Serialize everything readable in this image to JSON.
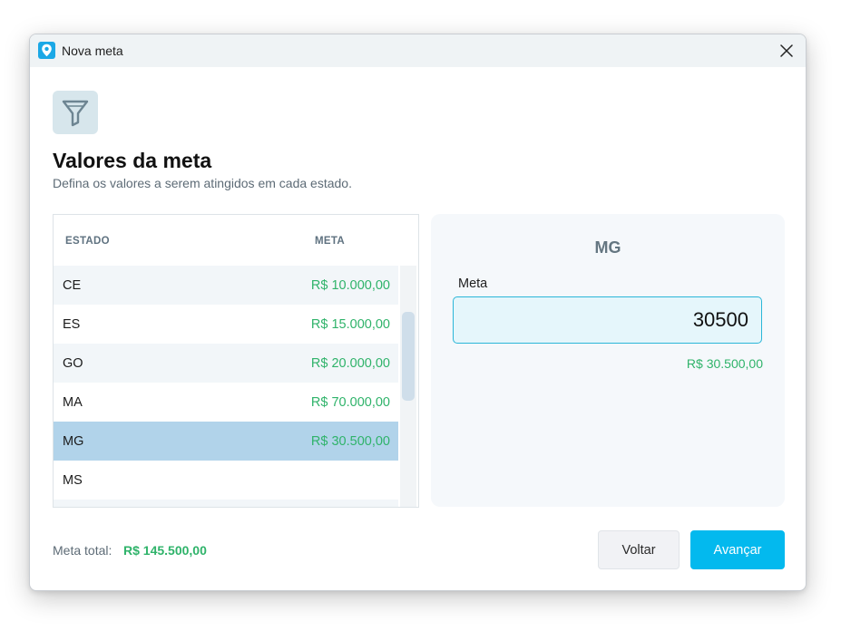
{
  "window": {
    "title": "Nova meta",
    "app_icon": "map-pin-icon",
    "close_icon": "close-icon"
  },
  "header": {
    "icon": "funnel-icon",
    "title": "Valores da meta",
    "subtitle": "Defina os valores a serem atingidos em cada estado."
  },
  "table": {
    "columns": [
      "ESTADO",
      "META"
    ],
    "rows": [
      {
        "state": "CE",
        "goal": "R$ 10.000,00"
      },
      {
        "state": "ES",
        "goal": "R$ 15.000,00"
      },
      {
        "state": "GO",
        "goal": "R$ 20.000,00"
      },
      {
        "state": "MA",
        "goal": "R$ 70.000,00"
      },
      {
        "state": "MG",
        "goal": "R$ 30.500,00"
      },
      {
        "state": "MS",
        "goal": ""
      },
      {
        "state": "",
        "goal": ""
      }
    ],
    "selected_state": "MG"
  },
  "detail": {
    "state": "MG",
    "label": "Meta",
    "value": "30500",
    "formatted": "R$ 30.500,00"
  },
  "footer": {
    "total_label": "Meta total:",
    "total_value": "R$ 145.500,00",
    "back_label": "Voltar",
    "next_label": "Avançar"
  },
  "colors": {
    "accent": "#03b9ee",
    "money": "#2fb36a",
    "selected_row": "#b1d3ea"
  }
}
